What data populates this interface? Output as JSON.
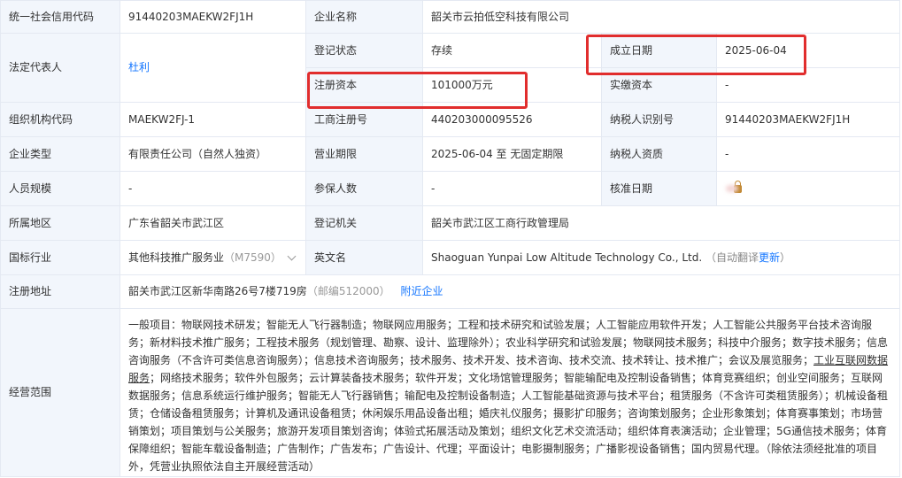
{
  "labels": {
    "credit_code": "统一社会信用代码",
    "company_name": "企业名称",
    "legal_rep": "法定代表人",
    "reg_status": "登记状态",
    "founded": "成立日期",
    "reg_capital": "注册资本",
    "paid_capital": "实缴资本",
    "org_code": "组织机构代码",
    "biz_reg_no": "工商注册号",
    "taxpayer_id": "纳税人识别号",
    "company_type": "企业类型",
    "term": "营业期限",
    "taxpayer_qual": "纳税人资质",
    "staff_size": "人员规模",
    "insured": "参保人数",
    "approval_date": "核准日期",
    "region": "所属地区",
    "reg_authority": "登记机关",
    "industry": "国标行业",
    "english_name": "英文名",
    "address": "注册地址",
    "scope": "经营范围"
  },
  "values": {
    "credit_code": "91440203MAEKW2FJ1H",
    "company_name": "韶关市云拍低空科技有限公司",
    "legal_rep": "杜利",
    "reg_status": "存续",
    "founded": "2025-06-04",
    "reg_capital": "101000万元",
    "paid_capital": "-",
    "org_code": "MAEKW2FJ-1",
    "biz_reg_no": "440203000095526",
    "taxpayer_id": "91440203MAEKW2FJ1H",
    "company_type": "有限责任公司（自然人独资）",
    "term": "2025-06-04 至 无固定期限",
    "taxpayer_qual": "-",
    "staff_size": "-",
    "insured": "-",
    "approval_date": "",
    "region": "广东省韶关市武江区",
    "reg_authority": "韶关市武江区工商行政管理局",
    "industry": "其他科技推广服务业",
    "industry_code": "（M7590）",
    "english_name": "Shaoguan Yunpai Low Altitude Technology Co., Ltd.",
    "auto_translate": "（自动翻译",
    "update_link": "更新",
    "auto_translate_close": "）",
    "address": "韶关市武江区新华南路26号7楼719房",
    "postcode": "（邮编512000）",
    "nearby_link": "附近企业"
  },
  "scope": {
    "part1": "一般项目：物联网技术研发；智能无人飞行器制造；物联网应用服务；工程和技术研究和试验发展；人工智能应用软件开发；人工智能公共服务平台技术咨询服务；新材料技术推广服务；工程技术服务（规划管理、勘察、设计、监理除外）；农业科学研究和试验发展；物联网技术服务；科技中介服务；数字技术服务；信息咨询服务（不含许可类信息咨询服务）；信息技术咨询服务；技术服务、技术开发、技术咨询、技术交流、技术转让、技术推广；会议及展览服务；",
    "kw": "工业互联网数据服务",
    "part2": "；网络技术服务；软件外包服务；云计算装备技术服务；软件开发；文化场馆管理服务；智能输配电及控制设备销售；体育竞赛组织；创业空间服务；互联网数据服务；信息系统运行维护服务；智能无人飞行器销售；输配电及控制设备制造；人工智能基础资源与技术平台；租赁服务（不含许可类租赁服务）；机械设备租赁；仓储设备租赁服务；计算机及通讯设备租赁；休闲娱乐用品设备出租；婚庆礼仪服务；摄影扩印服务；咨询策划服务；企业形象策划；体育赛事策划；市场营销策划；项目策划与公关服务；旅游开发项目策划咨询；体验式拓展活动及策划；组织文化艺术交流活动；组织体育表演活动；企业管理；5G通信技术服务；体育保障组织；智能车载设备制造；广告制作；广告发布；广告设计、代理；平面设计；电影摄制服务；广播影视设备销售；国内贸易代理。（除依法须经批准的项目外，凭营业执照依法自主开展经营活动）"
  },
  "colors": {
    "label_bg": "#f2f6fc",
    "link": "#1677ff",
    "highlight": "#e12d2d",
    "border": "#e4e9f2"
  }
}
